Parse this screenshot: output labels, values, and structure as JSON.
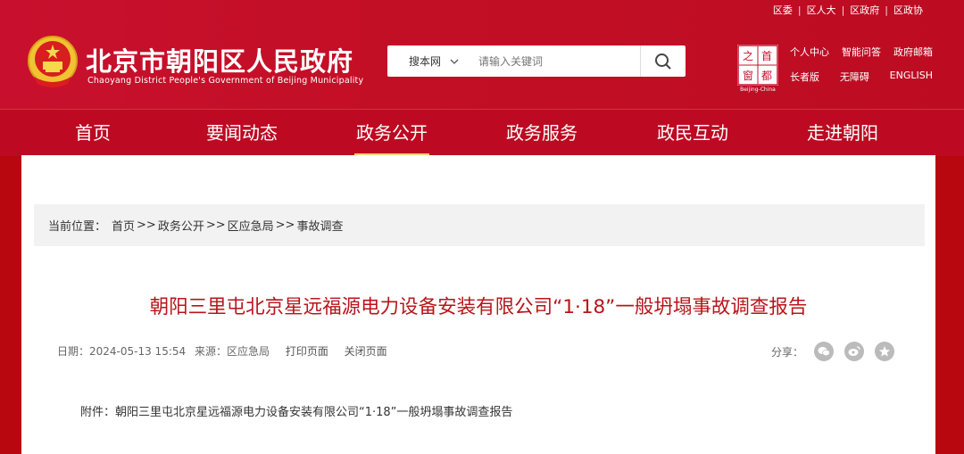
{
  "top_links": [
    "区委",
    "区人大",
    "区政府",
    "区政协"
  ],
  "site": {
    "title": "北京市朝阳区人民政府",
    "subtitle": "Chaoyang District People's Government of Beijing Municipality"
  },
  "search": {
    "scope": "搜本网",
    "placeholder": "请输入关键词"
  },
  "capital_logo": {
    "chars": [
      "首",
      "都",
      "之",
      "窗"
    ],
    "caption": "Beijing-China"
  },
  "quick_links": {
    "row1": [
      "个人中心",
      "智能问答",
      "政府邮箱"
    ],
    "row2": [
      "长者版",
      "无障碍",
      "ENGLISH"
    ]
  },
  "nav": [
    "首页",
    "要闻动态",
    "政务公开",
    "政务服务",
    "政民互动",
    "走进朝阳"
  ],
  "nav_active": "政务公开",
  "breadcrumb": {
    "label": "当前位置：",
    "items": [
      "首页",
      "政务公开",
      "区应急局",
      "事故调查"
    ],
    "sep": ">>"
  },
  "article": {
    "title": "朝阳三里屯北京星远福源电力设备安装有限公司“1·18”一般坍塌事故调查报告",
    "date": "日期：2024-05-13 15:54",
    "source": "来源：区应急局",
    "print": "打印页面",
    "close": "关闭页面",
    "share_label": "分享：",
    "attachment": "附件：朝阳三里屯北京星远福源电力设备安装有限公司“1·18”一般坍塌事故调查报告"
  },
  "colors": {
    "brand_red": "#c8102e",
    "title_red": "#b8141a",
    "nav_underline": "#f6d37a"
  }
}
